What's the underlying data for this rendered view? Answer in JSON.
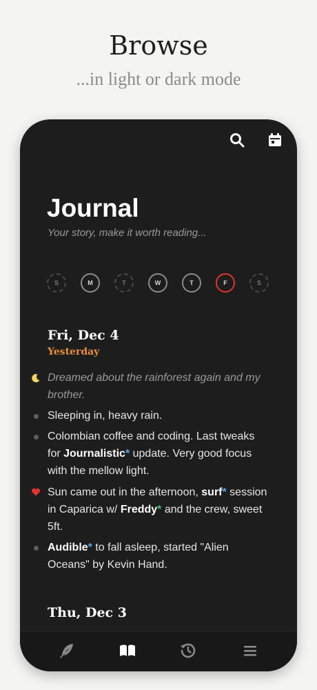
{
  "hero": {
    "title": "Browse",
    "subtitle": "...in light or dark mode"
  },
  "topbar": {
    "icons": [
      "search-icon",
      "calendar-icon"
    ]
  },
  "journal": {
    "title": "Journal",
    "tagline": "Your story, make it worth reading..."
  },
  "week": {
    "days": [
      "S",
      "M",
      "T",
      "W",
      "T",
      "F",
      "S"
    ],
    "active_index": 5
  },
  "days": [
    {
      "date": "Fri, Dec 4",
      "relative": "Yesterday",
      "entries": [
        {
          "marker": "moon-icon",
          "text": "Dreamed about the rainforest again and my brother."
        },
        {
          "marker": "dot",
          "text": "Sleeping in, heavy rain."
        },
        {
          "marker": "dot",
          "pre": "Colombian coffee and coding. Last tweaks for ",
          "tag": "Journalistic",
          "post": " update. Very good focus with the mellow light."
        },
        {
          "marker": "heart-icon",
          "pre": "Sun came out in the afternoon, ",
          "tag1": "surf",
          "mid": " session in Caparica w/ ",
          "tag2": "Freddy",
          "post": " and the crew, sweet 5ft."
        },
        {
          "marker": "dot",
          "tag": "Audible",
          "post": " to fall asleep, started \"Alien Oceans\" by Kevin Hand."
        }
      ]
    },
    {
      "date": "Thu, Dec 3"
    }
  ],
  "star": "*",
  "nav": {
    "icons": [
      "feather-icon",
      "book-icon",
      "history-icon",
      "menu-icon"
    ],
    "active": "book-icon"
  },
  "colors": {
    "background": "#f4f4f2",
    "phone": "#1d1d1d",
    "accent_orange": "#e8903a",
    "today_ring": "#e0342f",
    "heart": "#e0342f",
    "tag_blue": "#5aa2e6",
    "tag_green": "#3ec46d"
  }
}
